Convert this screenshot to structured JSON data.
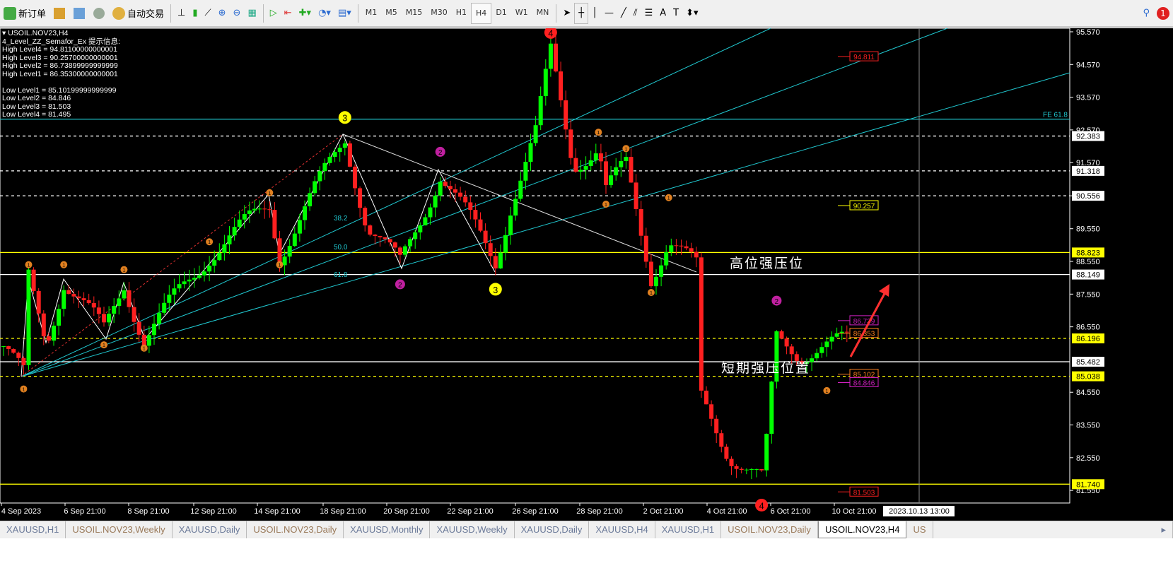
{
  "toolbar": {
    "new_order": "新订单",
    "auto_trading": "自动交易",
    "timeframes": [
      "M1",
      "M5",
      "M15",
      "M30",
      "H1",
      "H4",
      "D1",
      "W1",
      "MN"
    ],
    "active_timeframe": "H4",
    "notifications": "1"
  },
  "info": {
    "symbol": "USOIL.NOV23,H4",
    "indicator": "4_Level_ZZ_Semafor_Ex 提示信息:",
    "lines": [
      "High Level4 = 94.81100000000001",
      "High Level3 = 90.25700000000001",
      "High Level2 = 86.73899999999999",
      "High Level1 = 86.35300000000001",
      "",
      "Low Level1 = 85.10199999999999",
      "Low Level2 = 84.846",
      "Low Level3 = 81.503",
      "Low Level4 = 81.495"
    ]
  },
  "annotations": {
    "high_resistance": "高位强压位",
    "short_resistance": "短期强压位置",
    "fe": "FE 61.8",
    "fib382": "38.2",
    "fib500": "50.0",
    "fib618": "61.8"
  },
  "chart_data": {
    "type": "candlestick",
    "symbol": "USOIL.NOV23",
    "timeframe": "H4",
    "ylim": [
      81.3,
      95.9
    ],
    "yticks": [
      95.57,
      94.57,
      93.57,
      92.57,
      91.57,
      90.556,
      89.55,
      88.55,
      87.55,
      86.55,
      84.55,
      83.55,
      82.55,
      81.55
    ],
    "xticks": [
      "4 Sep 2023",
      "6 Sep 21:00",
      "8 Sep 21:00",
      "12 Sep 21:00",
      "14 Sep 21:00",
      "18 Sep 21:00",
      "20 Sep 21:00",
      "22 Sep 21:00",
      "26 Sep 21:00",
      "28 Sep 21:00",
      "2 Oct 21:00",
      "4 Oct 21:00",
      "6 Oct 21:00",
      "10 Oct 21:00"
    ],
    "crosshair_time": "2023.10.13 13:00",
    "price_waypoints": [
      [
        0,
        85.96
      ],
      [
        4,
        85.03
      ],
      [
        5,
        88.0
      ],
      [
        8.5,
        86.07
      ],
      [
        12,
        88.0
      ],
      [
        20,
        86.4
      ],
      [
        24,
        87.9
      ],
      [
        28,
        86.2
      ],
      [
        41,
        88.77
      ],
      [
        53,
        90.28
      ],
      [
        55,
        88.77
      ],
      [
        68,
        92.33
      ],
      [
        72.5,
        89.63
      ],
      [
        79,
        88.44
      ],
      [
        87,
        91.25
      ],
      [
        98,
        88.55
      ],
      [
        101,
        90.28
      ],
      [
        106,
        92.44
      ],
      [
        109,
        94.92
      ],
      [
        113.5,
        91.57
      ],
      [
        118.5,
        92.0
      ],
      [
        120,
        90.7
      ],
      [
        124,
        91.47
      ],
      [
        129,
        88.12
      ],
      [
        132.5,
        89.2
      ],
      [
        138,
        88.34
      ],
      [
        139,
        84.34
      ],
      [
        144.5,
        82.7
      ],
      [
        151,
        81.85
      ],
      [
        152,
        82.93
      ],
      [
        154,
        86.17
      ],
      [
        158.5,
        85.74
      ],
      [
        162.7,
        85.96
      ],
      [
        168,
        86.07
      ]
    ],
    "hlines": [
      {
        "price": 88.823,
        "label": "88.823",
        "color": "#ffff00",
        "style": "solid"
      },
      {
        "price": 88.149,
        "label": "88.149",
        "color": "#ffffff",
        "style": "solid"
      },
      {
        "price": 85.482,
        "label": "85.482",
        "color": "#ffffff",
        "style": "solid"
      },
      {
        "price": 86.196,
        "label": "86.196",
        "color": "#ffff00",
        "style": "dash"
      },
      {
        "price": 85.038,
        "label": "85.038",
        "color": "#ffff00",
        "style": "dash"
      },
      {
        "price": 92.383,
        "label": "92.383",
        "color": "#ffffff",
        "style": "dash"
      },
      {
        "price": 91.318,
        "label": "91.318",
        "color": "#ffffff",
        "style": "dash"
      },
      {
        "price": 90.556,
        "label": "90.556",
        "color": "#ffffff",
        "style": "dash"
      },
      {
        "price": 81.74,
        "label": "81.740",
        "color": "#ffff00",
        "style": "solid"
      },
      {
        "price": 92.9,
        "label": "",
        "color": "#20c8d0",
        "style": "solid"
      }
    ],
    "levels": [
      {
        "price": 94.811,
        "label": "94.811",
        "color": "#ff2020"
      },
      {
        "price": 90.257,
        "label": "90.257",
        "color": "#ffff00"
      },
      {
        "price": 86.739,
        "label": "86.739",
        "color": "#d020c0"
      },
      {
        "price": 86.353,
        "label": "86.353",
        "color": "#ff8020"
      },
      {
        "price": 85.102,
        "label": "85.102",
        "color": "#ff8020"
      },
      {
        "price": 84.846,
        "label": "84.846",
        "color": "#d020c0"
      },
      {
        "price": 81.503,
        "label": "81.503",
        "color": "#ff2020"
      }
    ],
    "semafor": [
      {
        "bar": 109,
        "price": 95.55,
        "n": "4",
        "c": "#ff2020"
      },
      {
        "bar": 68,
        "price": 92.95,
        "n": "3",
        "c": "#ffff00"
      },
      {
        "bar": 98,
        "price": 87.7,
        "n": "3",
        "c": "#ffff00"
      },
      {
        "bar": 151,
        "price": 81.1,
        "n": "4",
        "c": "#ff2020"
      },
      {
        "bar": 87,
        "price": 91.9,
        "n": "2",
        "c": "#c020a0"
      },
      {
        "bar": 79,
        "price": 87.85,
        "n": "2",
        "c": "#c020a0"
      },
      {
        "bar": 154,
        "price": 87.35,
        "n": "2",
        "c": "#c020a0"
      },
      {
        "bar": 4,
        "price": 84.65,
        "n": "1",
        "c": "#e08020"
      },
      {
        "bar": 5,
        "price": 88.45,
        "n": "1",
        "c": "#e08020"
      },
      {
        "bar": 12,
        "price": 88.45,
        "n": "1",
        "c": "#e08020"
      },
      {
        "bar": 24,
        "price": 88.3,
        "n": "1",
        "c": "#e08020"
      },
      {
        "bar": 20,
        "price": 86.0,
        "n": "1",
        "c": "#e08020"
      },
      {
        "bar": 28,
        "price": 85.9,
        "n": "1",
        "c": "#e08020"
      },
      {
        "bar": 41,
        "price": 89.15,
        "n": "1",
        "c": "#e08020"
      },
      {
        "bar": 53,
        "price": 90.65,
        "n": "1",
        "c": "#e08020"
      },
      {
        "bar": 55,
        "price": 88.45,
        "n": "1",
        "c": "#e08020"
      },
      {
        "bar": 118.5,
        "price": 92.5,
        "n": "1",
        "c": "#e08020"
      },
      {
        "bar": 124,
        "price": 92.0,
        "n": "1",
        "c": "#e08020"
      },
      {
        "bar": 120,
        "price": 90.3,
        "n": "1",
        "c": "#e08020"
      },
      {
        "bar": 132.5,
        "price": 90.5,
        "n": "1",
        "c": "#e08020"
      },
      {
        "bar": 129,
        "price": 87.6,
        "n": "1",
        "c": "#e08020"
      },
      {
        "bar": 164,
        "price": 84.6,
        "n": "1",
        "c": "#e08020"
      }
    ]
  },
  "tabs": [
    "XAUUSD,H1",
    "USOIL.NOV23,Weekly",
    "XAUUSD,Daily",
    "USOIL.NOV23,Daily",
    "XAUUSD,Monthly",
    "XAUUSD,Weekly",
    "XAUUSD,Daily",
    "XAUUSD,H4",
    "XAUUSD,H1",
    "USOIL.NOV23,Daily",
    "USOIL.NOV23,H4",
    "US"
  ],
  "active_tab": "USOIL.NOV23,H4"
}
